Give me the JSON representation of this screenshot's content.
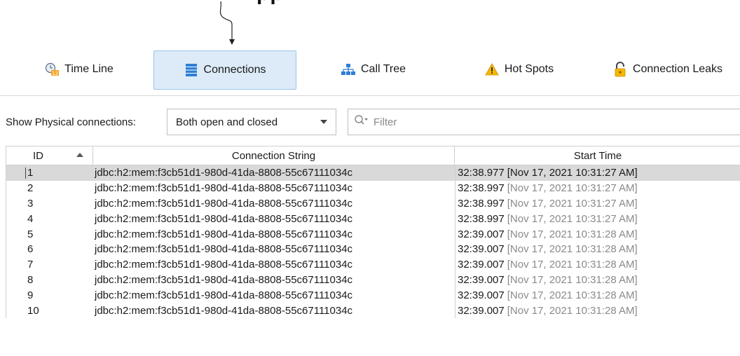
{
  "caption_fragment": "pp",
  "tabs": [
    {
      "label": "Time Line",
      "icon": "timeline-clock-icon",
      "active": false
    },
    {
      "label": "Connections",
      "icon": "database-icon",
      "active": true
    },
    {
      "label": "Call Tree",
      "icon": "call-tree-icon",
      "active": false
    },
    {
      "label": "Hot Spots",
      "icon": "warning-icon",
      "active": false
    },
    {
      "label": "Connection Leaks",
      "icon": "unlocked-padlock-icon",
      "active": false
    }
  ],
  "filter": {
    "label": "Show Physical connections:",
    "selected": "Both open and closed",
    "search_placeholder": "Filter"
  },
  "table": {
    "columns": [
      "ID",
      "Connection String",
      "Start Time"
    ],
    "sort": {
      "column": "ID",
      "direction": "ascending"
    },
    "selected_row": 0,
    "rows": [
      {
        "id": "1",
        "connection": "jdbc:h2:mem:f3cb51d1-980d-41da-8808-55c67111034c",
        "time": "32:38.977",
        "date": "[Nov 17, 2021 10:31:27 AM]"
      },
      {
        "id": "2",
        "connection": "jdbc:h2:mem:f3cb51d1-980d-41da-8808-55c67111034c",
        "time": "32:38.997",
        "date": "[Nov 17, 2021 10:31:27 AM]"
      },
      {
        "id": "3",
        "connection": "jdbc:h2:mem:f3cb51d1-980d-41da-8808-55c67111034c",
        "time": "32:38.997",
        "date": "[Nov 17, 2021 10:31:27 AM]"
      },
      {
        "id": "4",
        "connection": "jdbc:h2:mem:f3cb51d1-980d-41da-8808-55c67111034c",
        "time": "32:38.997",
        "date": "[Nov 17, 2021 10:31:27 AM]"
      },
      {
        "id": "5",
        "connection": "jdbc:h2:mem:f3cb51d1-980d-41da-8808-55c67111034c",
        "time": "32:39.007",
        "date": "[Nov 17, 2021 10:31:28 AM]"
      },
      {
        "id": "6",
        "connection": "jdbc:h2:mem:f3cb51d1-980d-41da-8808-55c67111034c",
        "time": "32:39.007",
        "date": "[Nov 17, 2021 10:31:28 AM]"
      },
      {
        "id": "7",
        "connection": "jdbc:h2:mem:f3cb51d1-980d-41da-8808-55c67111034c",
        "time": "32:39.007",
        "date": "[Nov 17, 2021 10:31:28 AM]"
      },
      {
        "id": "8",
        "connection": "jdbc:h2:mem:f3cb51d1-980d-41da-8808-55c67111034c",
        "time": "32:39.007",
        "date": "[Nov 17, 2021 10:31:28 AM]"
      },
      {
        "id": "9",
        "connection": "jdbc:h2:mem:f3cb51d1-980d-41da-8808-55c67111034c",
        "time": "32:39.007",
        "date": "[Nov 17, 2021 10:31:28 AM]"
      },
      {
        "id": "10",
        "connection": "jdbc:h2:mem:f3cb51d1-980d-41da-8808-55c67111034c",
        "time": "32:39.007",
        "date": "[Nov 17, 2021 10:31:28 AM]"
      }
    ]
  },
  "colors": {
    "active_tab_bg": "#dcebf7",
    "selected_row_bg": "#d9d9d9",
    "dim_text": "#8a8a8a"
  }
}
